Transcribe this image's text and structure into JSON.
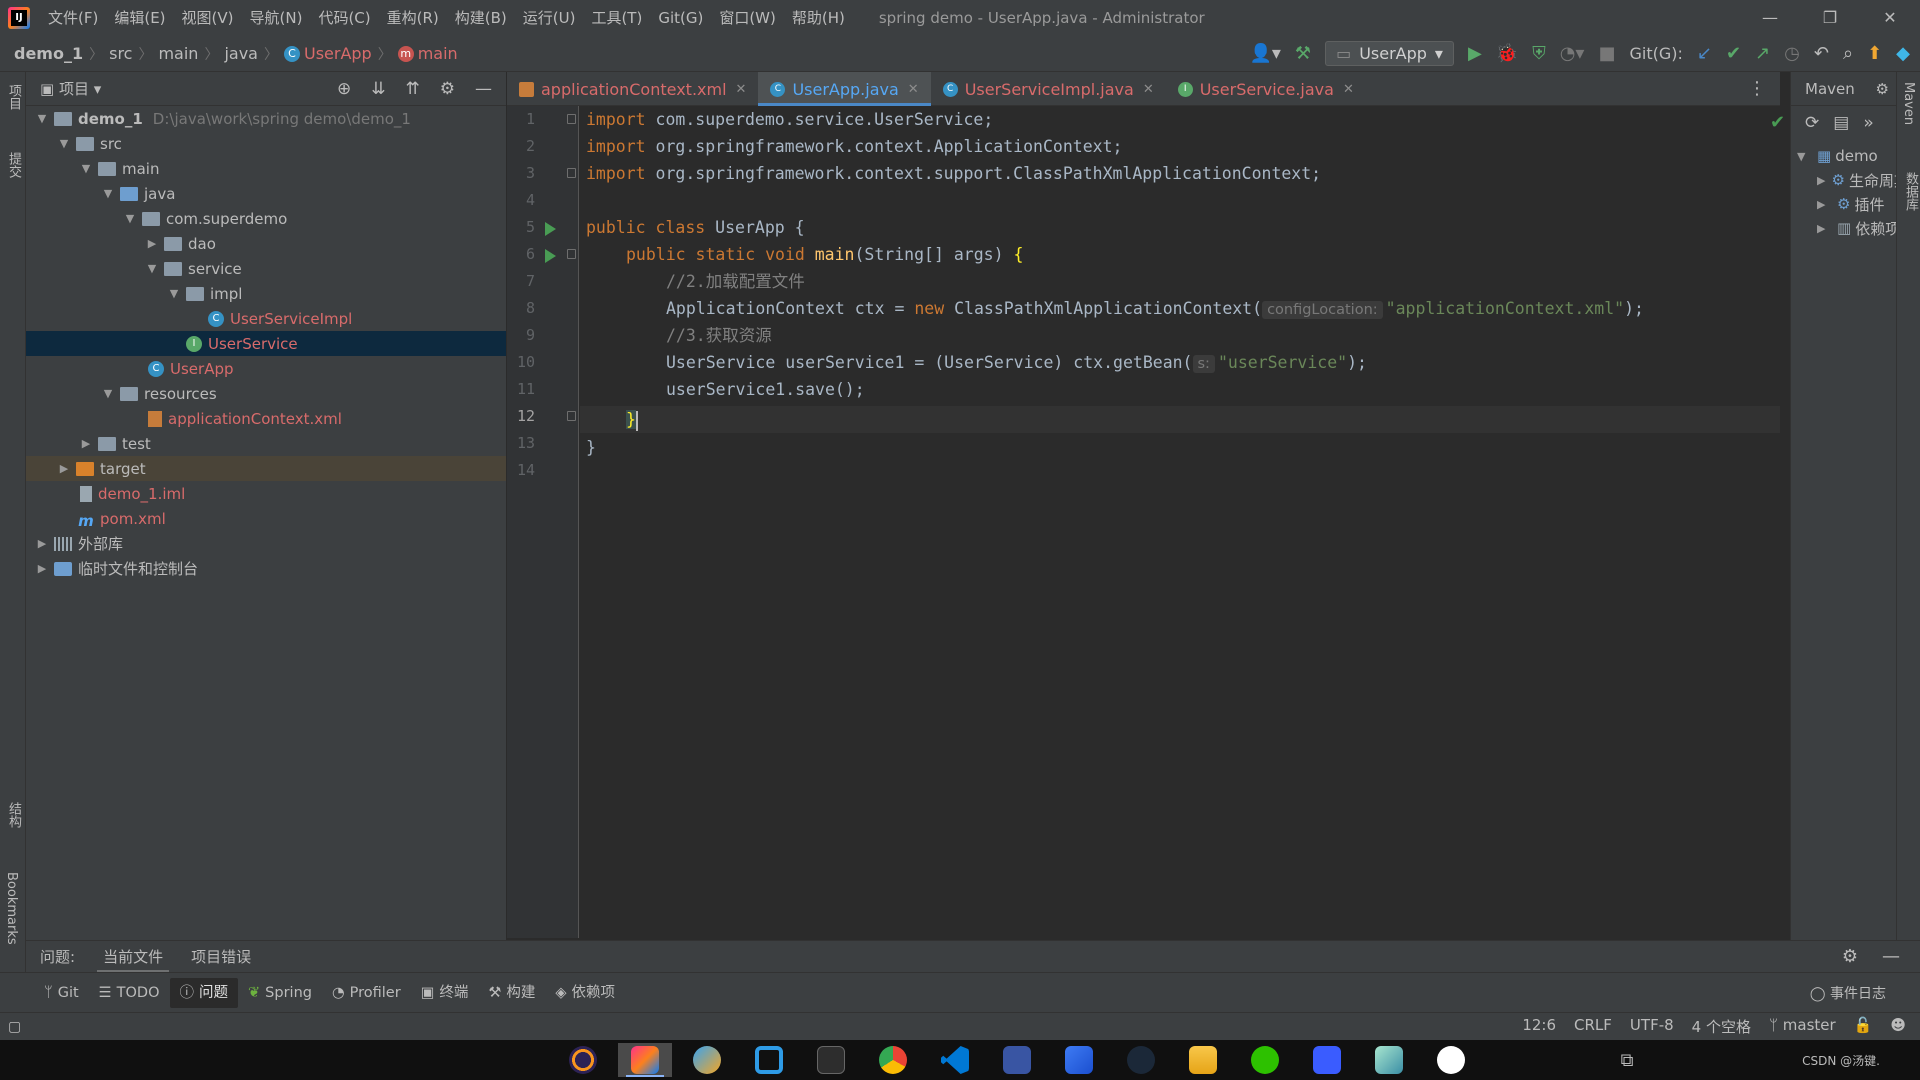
{
  "window": {
    "title": "spring demo - UserApp.java - Administrator",
    "menu": [
      "文件(F)",
      "编辑(E)",
      "视图(V)",
      "导航(N)",
      "代码(C)",
      "重构(R)",
      "构建(B)",
      "运行(U)",
      "工具(T)",
      "Git(G)",
      "窗口(W)",
      "帮助(H)"
    ]
  },
  "breadcrumb": {
    "items": [
      "demo_1",
      "src",
      "main",
      "java",
      "UserApp",
      "main"
    ]
  },
  "toolbar": {
    "run_config": "UserApp",
    "git_label": "Git(G):"
  },
  "project": {
    "header": "项目",
    "tree": [
      {
        "label": "demo_1",
        "path": "D:\\java\\work\\spring demo\\demo_1"
      },
      {
        "label": "src"
      },
      {
        "label": "main"
      },
      {
        "label": "java"
      },
      {
        "label": "com.superdemo"
      },
      {
        "label": "dao"
      },
      {
        "label": "service"
      },
      {
        "label": "impl"
      },
      {
        "label": "UserServiceImpl"
      },
      {
        "label": "UserService"
      },
      {
        "label": "UserApp"
      },
      {
        "label": "resources"
      },
      {
        "label": "applicationContext.xml"
      },
      {
        "label": "test"
      },
      {
        "label": "target"
      },
      {
        "label": "demo_1.iml"
      },
      {
        "label": "pom.xml"
      },
      {
        "label": "外部库"
      },
      {
        "label": "临时文件和控制台"
      }
    ]
  },
  "tabs": [
    {
      "label": "applicationContext.xml"
    },
    {
      "label": "UserApp.java"
    },
    {
      "label": "UserServiceImpl.java"
    },
    {
      "label": "UserService.java"
    }
  ],
  "editor": {
    "line_numbers": [
      "1",
      "2",
      "3",
      "4",
      "5",
      "6",
      "7",
      "8",
      "9",
      "10",
      "11",
      "12",
      "13",
      "14"
    ],
    "code": {
      "l1_kw": "import",
      "l1": " com.superdemo.service.UserService;",
      "l2_kw": "import",
      "l2": " org.springframework.context.ApplicationContext;",
      "l3_kw": "import",
      "l3": " org.springframework.context.support.ClassPathXmlApplicationContext;",
      "l5_kw": "public class",
      "l5": " UserApp {",
      "l6_kw": "public static void",
      "l6_fn": "main",
      "l6": "(String[] args) ",
      "l6_brace": "{",
      "l7": "//2.加载配置文件",
      "l8_a": "ApplicationContext ctx = ",
      "l8_kw": "new",
      "l8_b": " ClassPathXmlApplicationContext(",
      "l8_hint": "configLocation:",
      "l8_str": "\"applicationContext.xml\"",
      "l8_c": ");",
      "l9": "//3.获取资源",
      "l10_a": "UserService userService1 = (UserService) ctx.getBean(",
      "l10_hint": "s:",
      "l10_str": "\"userService\"",
      "l10_c": ");",
      "l11": "userService1.save();",
      "l12": "}",
      "l13": "}"
    }
  },
  "maven": {
    "title": "Maven",
    "items": [
      "demo",
      "生命周期",
      "插件",
      "依赖项"
    ]
  },
  "left_strip": {
    "project": "项目",
    "commit": "提交",
    "structure": "结构",
    "bookmarks": "Bookmarks"
  },
  "right_strip": {
    "maven": "Maven",
    "database": "数据库"
  },
  "problems_bar": {
    "label": "问题:",
    "tabs": [
      "当前文件",
      "项目错误"
    ]
  },
  "tool_windows": [
    "Git",
    "TODO",
    "问题",
    "Spring",
    "Profiler",
    "终端",
    "构建",
    "依赖项"
  ],
  "event_log": "事件日志",
  "status": {
    "position": "12:6",
    "line_sep": "CRLF",
    "encoding": "UTF-8",
    "indent": "4 个空格",
    "branch": "master"
  },
  "watermark": "CSDN @汤键."
}
